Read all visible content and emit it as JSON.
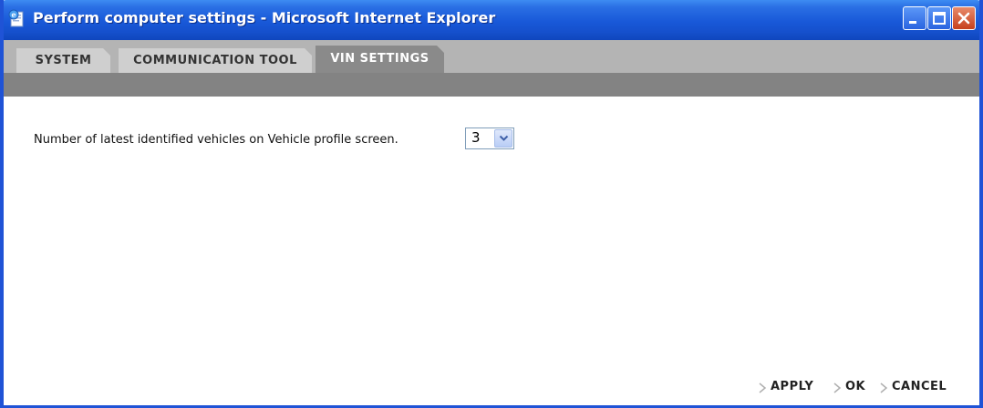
{
  "window": {
    "title": "Perform computer settings - Microsoft Internet Explorer",
    "icon": "ie-page-icon",
    "controls": [
      "minimize-icon",
      "maximize-icon",
      "close-icon"
    ]
  },
  "tabs": [
    {
      "label": "SYSTEM",
      "active": false
    },
    {
      "label": "COMMUNICATION TOOL",
      "active": false
    },
    {
      "label": "VIN SETTINGS",
      "active": true
    }
  ],
  "settings": {
    "vehicles_label": "Number of latest identified vehicles on Vehicle profile screen.",
    "vehicles_value": "3"
  },
  "actions": {
    "apply": "APPLY",
    "ok": "OK",
    "cancel": "CANCEL"
  },
  "colors": {
    "titlebar": "#1f53d6",
    "tab_active": "#8a8a8a",
    "tab_inactive": "#cfcfcf",
    "band": "#838383"
  }
}
